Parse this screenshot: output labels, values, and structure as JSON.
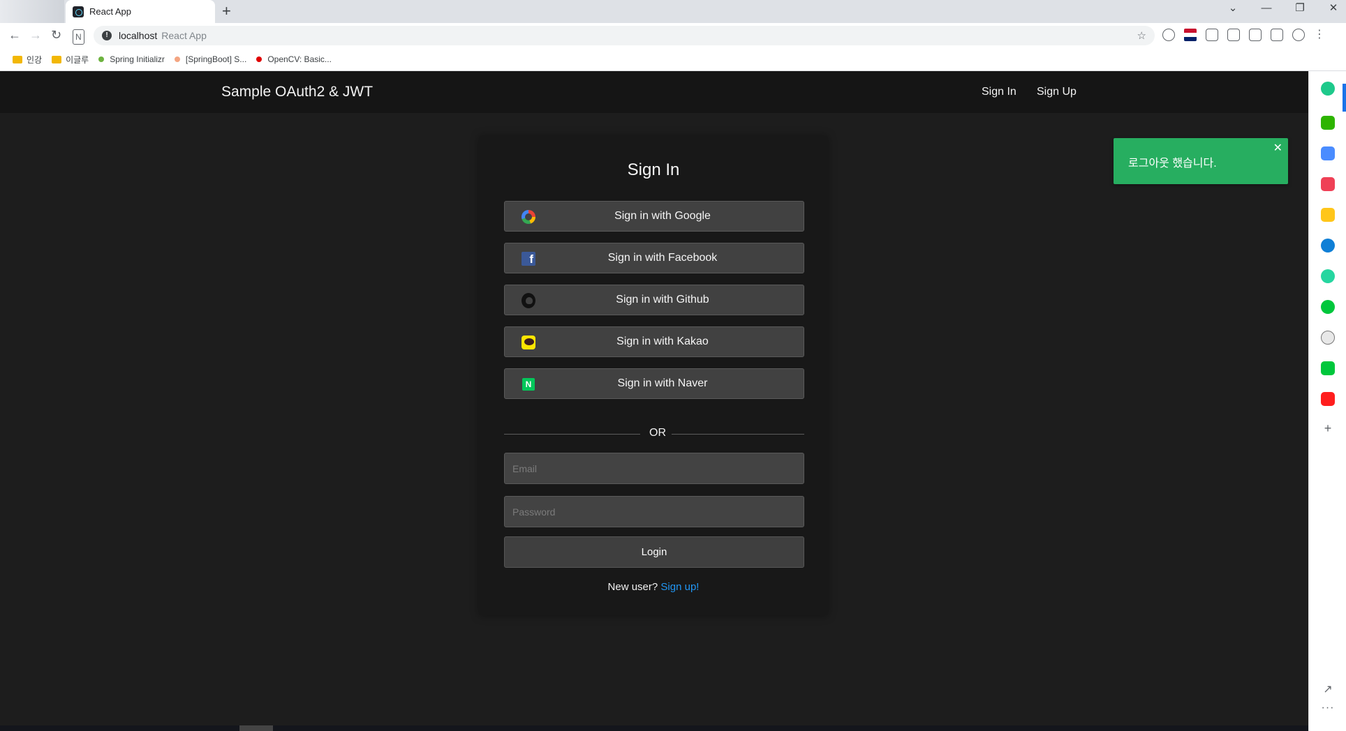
{
  "browser": {
    "tab_title": "React App",
    "new_tab": "+",
    "controls": {
      "dropdown": "⌄",
      "minimize": "—",
      "restore": "❐",
      "close": "✕"
    },
    "url_host": "localhost",
    "url_page_title": "React App",
    "bookmarks": [
      {
        "label": "인강",
        "icon": "folder-icon"
      },
      {
        "label": "이글루",
        "icon": "folder-icon"
      },
      {
        "label": "Spring Initializr",
        "icon": "spring-dot-icon",
        "color": "#6db33f"
      },
      {
        "label": "[SpringBoot] S...",
        "icon": "blog-dot-icon",
        "color": "#f4a582"
      },
      {
        "label": "OpenCV: Basic...",
        "icon": "opencv-dot-icon",
        "color": "#e00000"
      }
    ]
  },
  "header": {
    "brand": "Sample OAuth2 & JWT",
    "nav": {
      "signin": "Sign In",
      "signup": "Sign Up"
    }
  },
  "signin": {
    "title": "Sign In",
    "social": {
      "google": "Sign in with Google",
      "facebook": "Sign in with Facebook",
      "github": "Sign in with Github",
      "kakao": "Sign in with Kakao",
      "naver": "Sign in with Naver"
    },
    "or": "OR",
    "email_placeholder": "Email",
    "password_placeholder": "Password",
    "login": "Login",
    "new_user": "New user?",
    "signup_link": "Sign up!"
  },
  "toast": {
    "message": "로그아웃 했습니다.",
    "close": "✕",
    "color": "#27ae60"
  },
  "colors": {
    "background": "#1d1d1d",
    "header": "#151515",
    "card": "#181818",
    "button": "#414141",
    "link": "#2196f3"
  }
}
